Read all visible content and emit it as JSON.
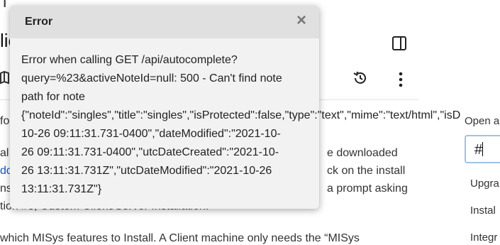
{
  "background": {
    "fragments": [
      {
        "key": "t1",
        "text": "T"
      },
      {
        "key": "t2",
        "text": "lie"
      },
      {
        "key": "t3",
        "text": "fo"
      },
      {
        "key": "t4",
        "text": "al"
      },
      {
        "key": "t5",
        "text": "do"
      },
      {
        "key": "t6",
        "text": "ns"
      },
      {
        "key": "t7",
        "text": "tion #3, Custom Client/Server Installation."
      },
      {
        "key": "t8",
        "text": "which MISys features to Install. A Client machine only needs the “MISys"
      },
      {
        "key": "t9",
        "text": "e downloaded"
      },
      {
        "key": "t10",
        "text": "ck on the install"
      },
      {
        "key": "t11",
        "text": "a prompt asking"
      }
    ],
    "colors": {
      "link": "#1a4fd6",
      "accent": "#9fc2e8"
    }
  },
  "toolbar": {
    "map_icon": "map-icon",
    "history_icon": "history-icon",
    "more_icon": "more-vertical-icon",
    "panel_icon": "sidebar-toggle-icon"
  },
  "right_panel": {
    "title": "Open a",
    "search_value": "#",
    "items": [
      "Upgra",
      "Instal",
      "Integr"
    ]
  },
  "dialog": {
    "title": "Error",
    "close_label": "×",
    "message_lines": [
      "Error when calling GET /api/autocomplete?",
      "query=%23&activeNoteId=null: 500 - Can't find note",
      "path for note",
      "{\"noteId\":\"singles\",\"title\":\"singles\",\"isProtected\":false,\"type\":\"text\",\"mime\":\"text/html\",\"isD",
      "10-26 09:11:31.731-0400\",\"dateModified\":\"2021-10-",
      "26 09:11:31.731-0400\",\"utcDateCreated\":\"2021-10-",
      "26 13:11:31.731Z\",\"utcDateModified\":\"2021-10-26",
      "13:11:31.731Z\"}"
    ]
  }
}
